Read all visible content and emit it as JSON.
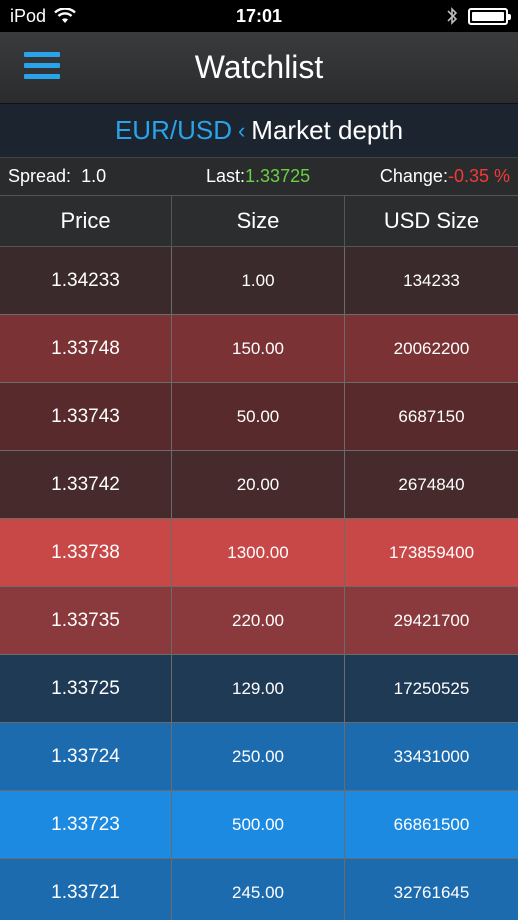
{
  "status": {
    "carrier": "iPod",
    "time": "17:01",
    "battery": 1.0
  },
  "navbar": {
    "title": "Watchlist",
    "menu_icon": "hamburger-menu-icon"
  },
  "subheader": {
    "pair": "EUR/USD",
    "chevron": "‹",
    "title": "Market depth"
  },
  "info": {
    "spread_label": "Spread:",
    "spread_value": "1.0",
    "last_label": "Last:",
    "last_value": "1.33725",
    "change_label": "Change:",
    "change_value": "-0.35 %"
  },
  "colors": {
    "accent": "#29a3ea",
    "positive": "#6ad142",
    "negative": "#f03a35"
  },
  "table": {
    "headers": [
      "Price",
      "Size",
      "USD Size"
    ],
    "rows": [
      {
        "price": "1.34233",
        "size": "1.00",
        "usd_size": "134233",
        "bg": "#3a2a2c"
      },
      {
        "price": "1.33748",
        "size": "150.00",
        "usd_size": "20062200",
        "bg": "#7a3234"
      },
      {
        "price": "1.33743",
        "size": "50.00",
        "usd_size": "6687150",
        "bg": "#582a2c"
      },
      {
        "price": "1.33742",
        "size": "20.00",
        "usd_size": "2674840",
        "bg": "#462a2c"
      },
      {
        "price": "1.33738",
        "size": "1300.00",
        "usd_size": "173859400",
        "bg": "#c84848"
      },
      {
        "price": "1.33735",
        "size": "220.00",
        "usd_size": "29421700",
        "bg": "#8a3a3c"
      },
      {
        "price": "1.33725",
        "size": "129.00",
        "usd_size": "17250525",
        "bg": "#1e3a55"
      },
      {
        "price": "1.33724",
        "size": "250.00",
        "usd_size": "33431000",
        "bg": "#1c6bae"
      },
      {
        "price": "1.33723",
        "size": "500.00",
        "usd_size": "66861500",
        "bg": "#1b8ae0"
      },
      {
        "price": "1.33721",
        "size": "245.00",
        "usd_size": "32761645",
        "bg": "#1c6bae"
      }
    ]
  }
}
